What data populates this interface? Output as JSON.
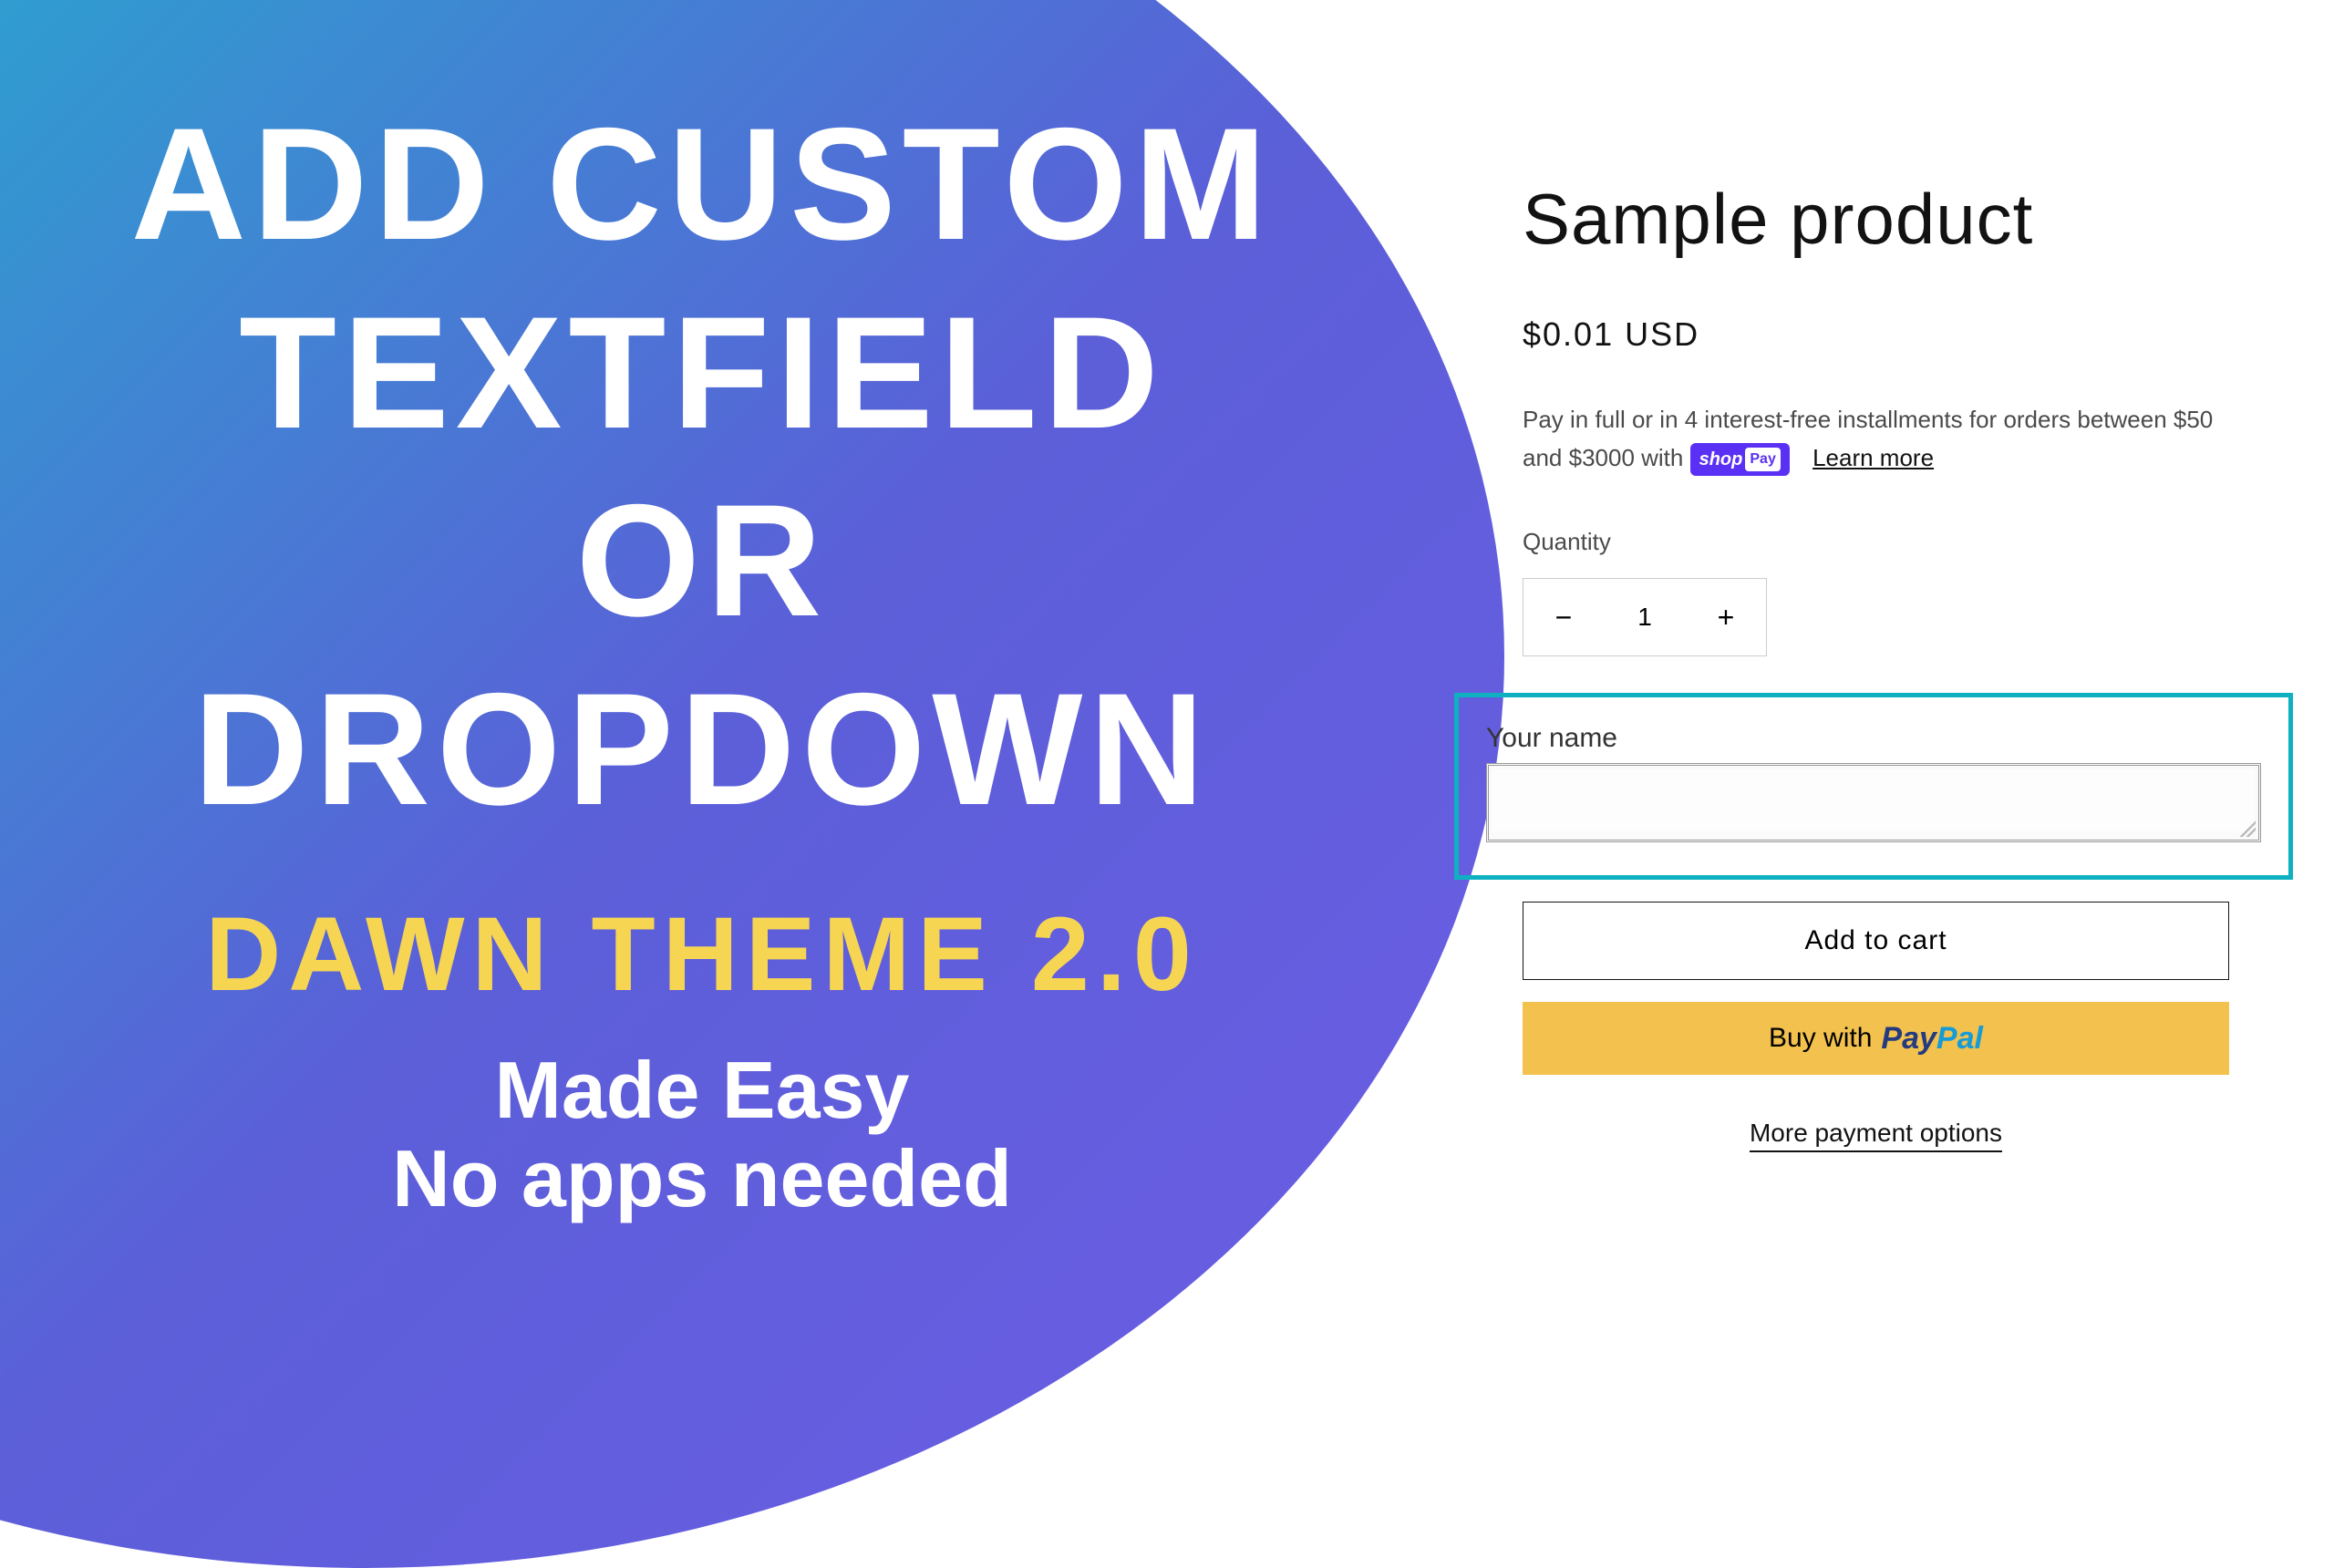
{
  "promo": {
    "headline_line1": "ADD CUSTOM",
    "headline_line2": "TEXTFIELD",
    "headline_line3": "OR",
    "headline_line4": "DROPDOWN",
    "subhead1": "DAWN THEME 2.0",
    "subhead2_line1": "Made Easy",
    "subhead2_line2": "No apps needed"
  },
  "product": {
    "title": "Sample product",
    "price": "$0.01 USD",
    "installments_prefix": "Pay in full or in 4 interest-free installments for orders between $50 and $3000 with ",
    "shop_text": "shop",
    "pay_text": "Pay",
    "learn_more": "Learn more",
    "quantity_label": "Quantity",
    "quantity_value": "1",
    "custom_field_label": "Your name",
    "custom_field_value": "",
    "add_to_cart": "Add to cart",
    "buy_with": "Buy with ",
    "paypal_pay": "Pay",
    "paypal_pal": "Pal",
    "more_options": "More payment options"
  }
}
